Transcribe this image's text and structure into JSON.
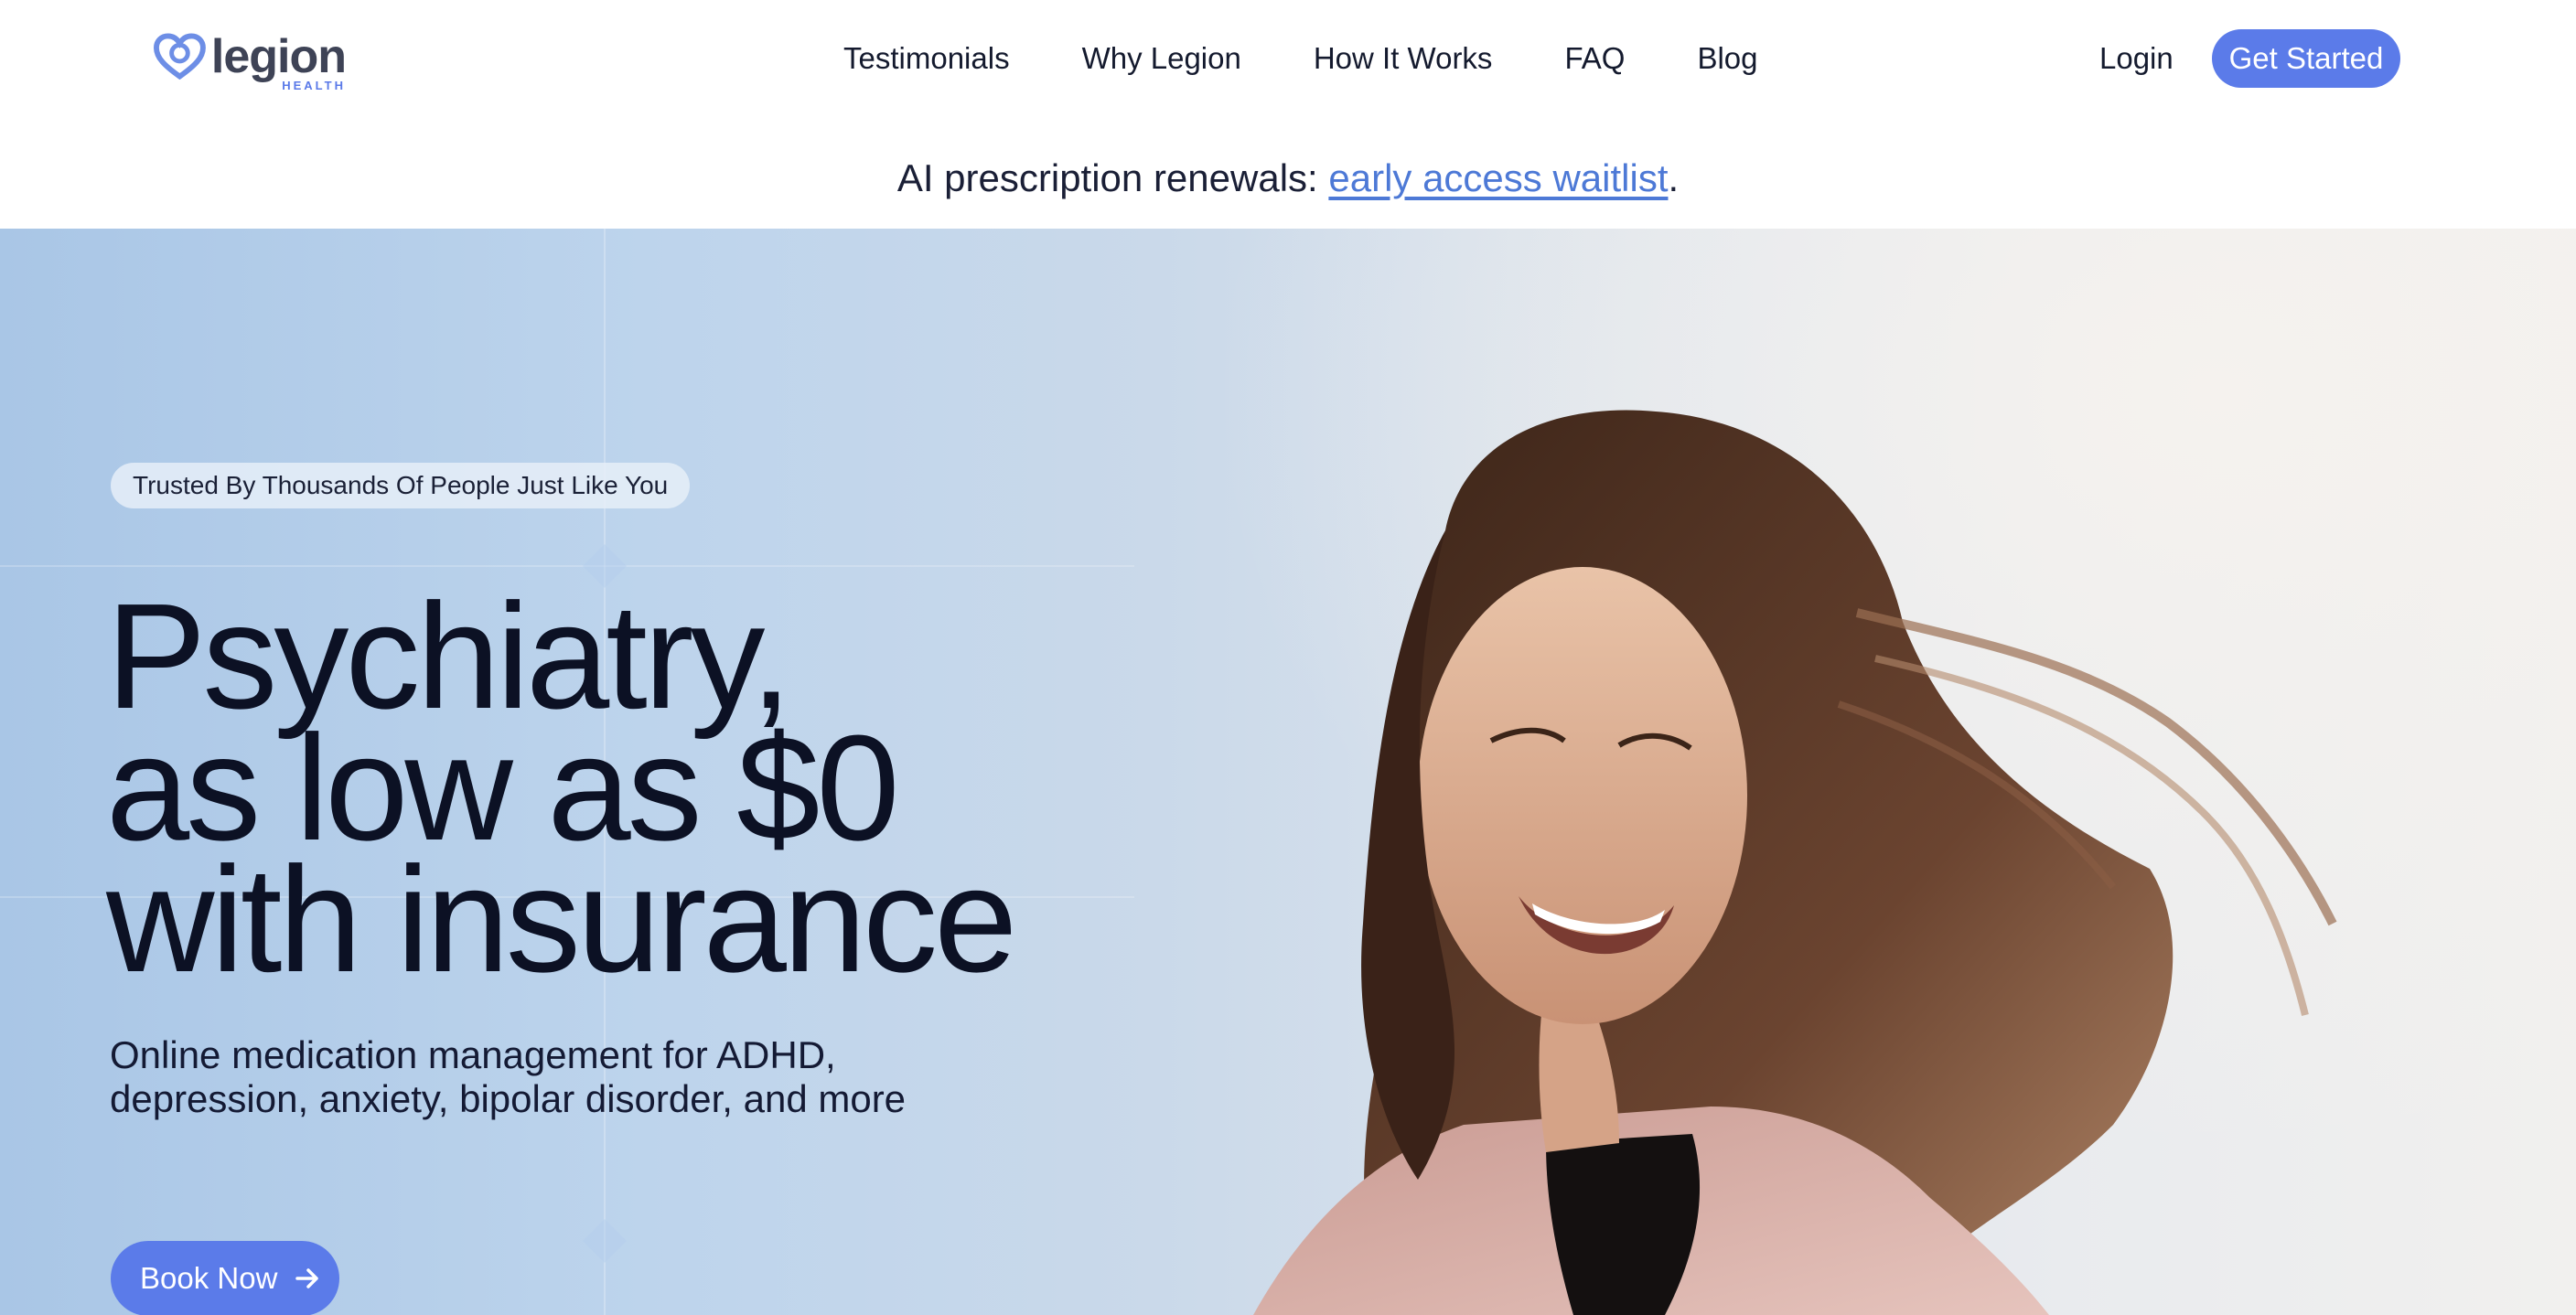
{
  "header": {
    "logo_word": "legion",
    "logo_sub": "HEALTH",
    "nav": [
      {
        "label": "Testimonials"
      },
      {
        "label": "Why Legion"
      },
      {
        "label": "How It Works"
      },
      {
        "label": "FAQ"
      },
      {
        "label": "Blog"
      }
    ],
    "login_label": "Login",
    "get_started_label": "Get Started"
  },
  "announcement": {
    "text": "AI prescription renewals: ",
    "link_text": "early access waitlist",
    "suffix": "."
  },
  "hero": {
    "badge": "Trusted By Thousands Of People Just Like You",
    "headline_lines": [
      "Psychiatry,",
      "as low as $0",
      "with insurance"
    ],
    "subtitle": "Online medication management for ADHD, depression, anxiety, bipolar disorder, and more",
    "cta_label": "Book Now"
  },
  "colors": {
    "accent": "#5b7be9",
    "link": "#4d79d6",
    "text": "#0c1124"
  },
  "icons": [
    "heart-logo-icon",
    "arrow-right-icon"
  ]
}
